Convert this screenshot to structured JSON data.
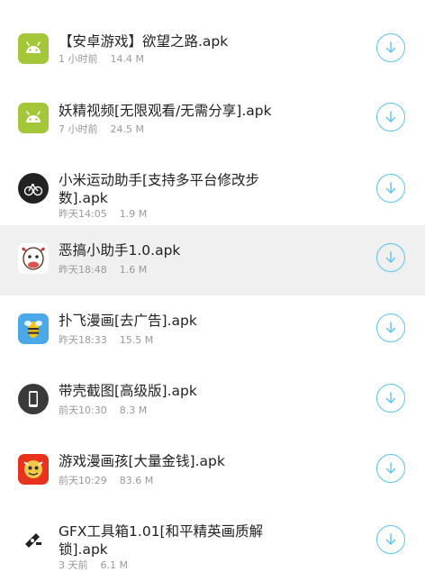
{
  "download_list": {
    "items": [
      {
        "title": "【安卓游戏】欲望之路.apk",
        "time": "1 小时前",
        "size": "14.4 M",
        "icon": "android-icon",
        "highlight": false
      },
      {
        "title": "妖精视频[无限观看/无需分享].apk",
        "time": "7 小时前",
        "size": "24.5 M",
        "icon": "android-icon",
        "highlight": false
      },
      {
        "title": "小米运动助手[支持多平台修改步数].apk",
        "time": "昨天14:05",
        "size": "1.9 M",
        "icon": "bike-icon",
        "highlight": false
      },
      {
        "title": "恶搞小助手1.0.apk",
        "time": "昨天18:48",
        "size": "1.6 M",
        "icon": "cow-face-icon",
        "highlight": true
      },
      {
        "title": "扑飞漫画[去广告].apk",
        "time": "昨天18:33",
        "size": "15.5 M",
        "icon": "bee-icon",
        "highlight": false
      },
      {
        "title": "带壳截图[高级版].apk",
        "time": "前天10:30",
        "size": "8.3 M",
        "icon": "phone-frame-icon",
        "highlight": false
      },
      {
        "title": "游戏漫画孩[大量金钱].apk",
        "time": "前天10:29",
        "size": "83.6 M",
        "icon": "comic-kid-icon",
        "highlight": false
      },
      {
        "title": "GFX工具箱1.01[和平精英画质解锁].apk",
        "time": "3 天前",
        "size": "6.1 M",
        "icon": "gun-tool-icon",
        "highlight": false
      }
    ]
  },
  "colors": {
    "download_accent": "#59c3f2",
    "android_green": "#a4c639",
    "highlight_row": "#f0f0f0"
  }
}
